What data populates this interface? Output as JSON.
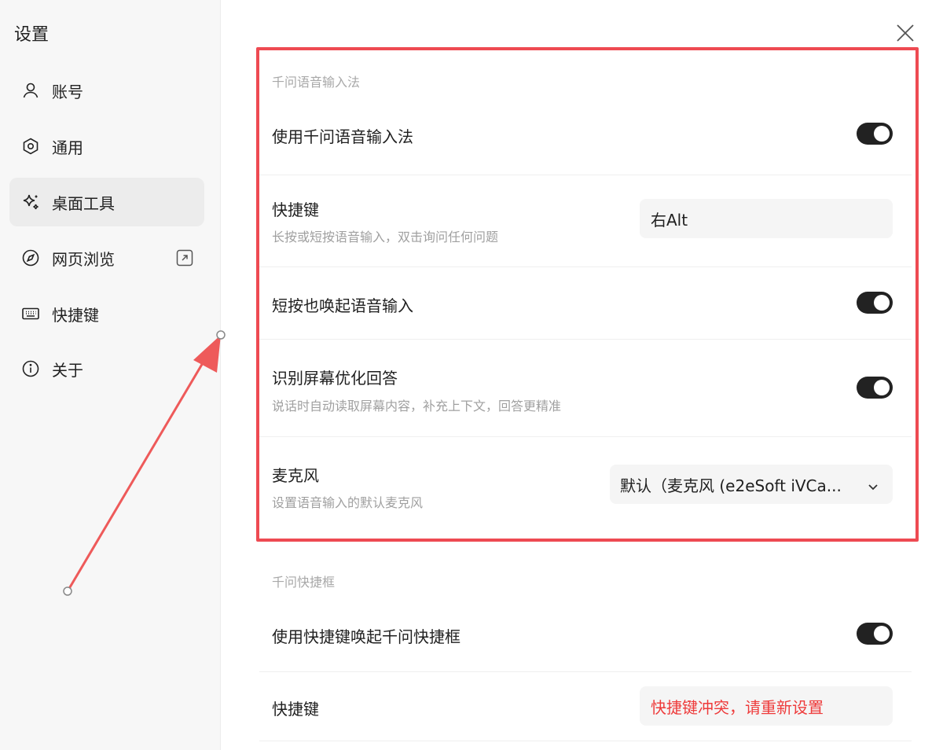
{
  "sidebar": {
    "title": "设置",
    "items": [
      {
        "label": "账号",
        "icon": "user-icon"
      },
      {
        "label": "通用",
        "icon": "hexagon-settings-icon"
      },
      {
        "label": "桌面工具",
        "icon": "sparkle-icon"
      },
      {
        "label": "网页浏览",
        "icon": "compass-icon"
      },
      {
        "label": "快捷键",
        "icon": "keyboard-icon"
      },
      {
        "label": "关于",
        "icon": "info-icon"
      }
    ],
    "active_index": 2
  },
  "voice_section": {
    "label": "千问语音输入法",
    "enable": {
      "title": "使用千问语音输入法",
      "on": true
    },
    "hotkey": {
      "title": "快捷键",
      "desc": "长按或短按语音输入，双击询问任何问题",
      "value": "右Alt"
    },
    "short_press": {
      "title": "短按也唤起语音输入",
      "on": true
    },
    "screen_opt": {
      "title": "识别屏幕优化回答",
      "desc": "说话时自动读取屏幕内容，补充上下文，回答更精准",
      "on": true
    },
    "microphone": {
      "title": "麦克风",
      "desc": "设置语音输入的默认麦克风",
      "value": "默认（麦克风 (e2eSoft iVCa..."
    }
  },
  "quickbox_section": {
    "label": "千问快捷框",
    "enable": {
      "title": "使用快捷键唤起千问快捷框",
      "on": true
    },
    "hotkey": {
      "title": "快捷键",
      "value": "快捷键冲突，请重新设置"
    }
  },
  "colors": {
    "accent_red": "#ee4a52",
    "toggle_on": "#222222",
    "error_text": "#ee3b3b"
  }
}
